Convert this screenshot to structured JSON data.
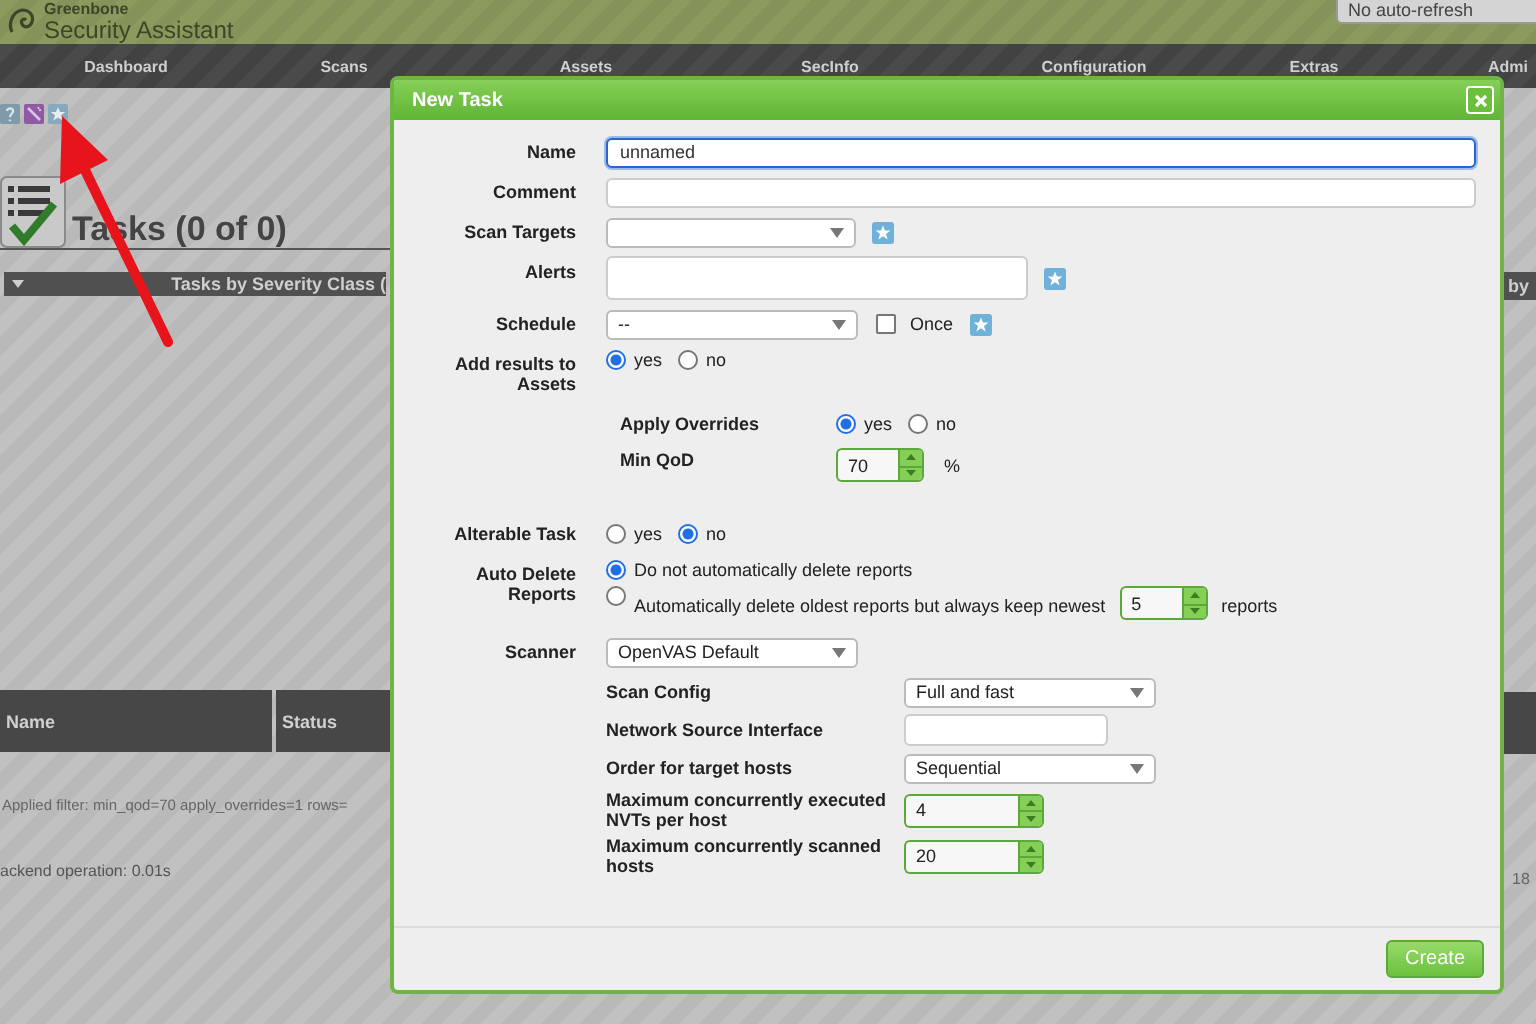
{
  "header": {
    "logo_top": "Greenbone",
    "logo_bottom": "Security Assistant",
    "refresh_select": "No auto-refresh"
  },
  "nav": [
    {
      "label": "Dashboard"
    },
    {
      "label": "Scans"
    },
    {
      "label": "Assets"
    },
    {
      "label": "SecInfo"
    },
    {
      "label": "Configuration"
    },
    {
      "label": "Extras"
    },
    {
      "label": "Admi"
    }
  ],
  "page_title": "Tasks (0 of 0)",
  "chart_panels": [
    {
      "title": "Tasks by Severity Class ("
    },
    {
      "title": "by"
    }
  ],
  "table": {
    "columns": [
      "Name",
      "Status"
    ]
  },
  "filter_text": "Applied filter: min_qod=70 apply_overrides=1 rows=",
  "backend_text": "ackend operation: 0.01s",
  "edge_text": "18",
  "dialog": {
    "title": "New Task",
    "name": {
      "label": "Name",
      "value": "unnamed",
      "focused": true
    },
    "comment": {
      "label": "Comment"
    },
    "scan_targets": {
      "label": "Scan Targets"
    },
    "alerts": {
      "label": "Alerts"
    },
    "schedule": {
      "label": "Schedule",
      "value": "--",
      "once": {
        "label": "Once",
        "checked": false
      }
    },
    "add_to_assets": {
      "label": "Add results to Assets",
      "options": [
        {
          "label": "yes",
          "selected": true
        },
        {
          "label": "no",
          "selected": false
        }
      ]
    },
    "apply_overrides": {
      "label": "Apply Overrides",
      "options": [
        {
          "label": "yes",
          "selected": true
        },
        {
          "label": "no",
          "selected": false
        }
      ]
    },
    "min_qod": {
      "label": "Min QoD",
      "value": "70",
      "unit": "%"
    },
    "alterable": {
      "label": "Alterable Task",
      "options": [
        {
          "label": "yes",
          "selected": false
        },
        {
          "label": "no",
          "selected": true
        }
      ]
    },
    "auto_delete": {
      "label": "Auto Delete Reports",
      "options": [
        {
          "kind": "plain",
          "label": "Do not automatically delete reports",
          "selected": true
        },
        {
          "kind": "keep",
          "label": "Automatically delete oldest reports but always keep newest",
          "value": "5",
          "unit": "reports",
          "selected": false
        }
      ]
    },
    "scanner": {
      "label": "Scanner",
      "value": "OpenVAS Default"
    },
    "scanner_options": [
      {
        "kind": "select",
        "label": "Scan Config",
        "value": "Full and fast"
      },
      {
        "kind": "text",
        "label": "Network Source Interface"
      },
      {
        "kind": "select",
        "label": "Order for target hosts",
        "value": "Sequential"
      },
      {
        "kind": "spinner",
        "label": "Maximum concurrently executed NVTs per host",
        "value": "4"
      },
      {
        "kind": "spinner",
        "label": "Maximum concurrently scanned hosts",
        "value": "20"
      }
    ],
    "create_button": "Create"
  }
}
